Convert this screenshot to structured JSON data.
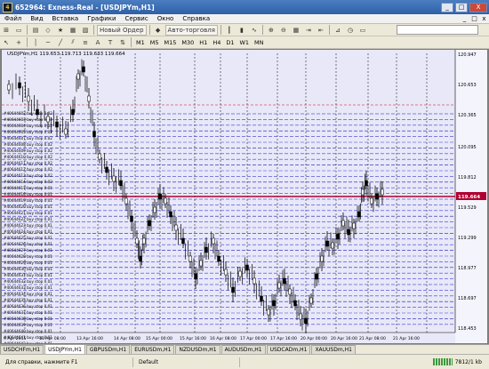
{
  "window": {
    "app_icon_text": "4",
    "title": "652964: Exness-Real - [USDJPYm,H1]",
    "minimize": "_",
    "maximize": "□",
    "close": "X"
  },
  "menu": [
    "Файл",
    "Вид",
    "Вставка",
    "Графики",
    "Сервис",
    "Окно",
    "Справка"
  ],
  "menu_sys": [
    "_",
    "□",
    "x"
  ],
  "toolbar1": {
    "new_order": "Новый Ордер",
    "auto_trading": "Авто-торговля"
  },
  "timeframes": [
    "M1",
    "M5",
    "M15",
    "M30",
    "H1",
    "H4",
    "D1",
    "W1",
    "MN"
  ],
  "chart": {
    "header": "USDJPYm,H1  119.653 119.713 119.633 119.664",
    "y_axis": [
      "120.947",
      "120.653",
      "120.365",
      "120.095",
      "119.812",
      "119.529",
      "119.299",
      "118.977",
      "118.697",
      "118.453",
      "119.115",
      "119.577"
    ],
    "x_labels": [
      "9 Apr 2015",
      "13 Apr 08:00",
      "13 Apr 16:00",
      "14 Apr 08:00",
      "15 Apr 00:00",
      "15 Apr 16:00",
      "16 Apr 08:00",
      "17 Apr 00:00",
      "17 Apr 16:00",
      "20 Apr 00:00",
      "20 Apr 16:00",
      "21 Apr 08:00",
      "21 Apr 16:00"
    ],
    "current_price": "119.664",
    "order_prefix": "#",
    "order_labels": [
      "#40644602 buy stop 0.02",
      "#40644603 buy stop 0.02",
      "#40644604 buy stop 0.02",
      "#40644605 buy stop 0.02",
      "#40644607 buy stop 0.02",
      "#40644608 buy stop 0.02",
      "#40644609 buy stop 0.02",
      "#40644610 buy stop 0.02",
      "#40644611 buy stop 0.02",
      "#40644612 buy stop 0.02",
      "#40644613 buy stop 0.02",
      "#40644614 buy stop 0.02",
      "#40644617 buy stop 0.01",
      "#40644618 buy stop 0.01",
      "#40644619 buy stop 0.01",
      "#40644620 buy stop 0.01",
      "#40644621 buy stop 0.01",
      "#40644622 buy stop 0.01",
      "#40644623 buy stop 0.01",
      "#40644624 buy stop 0.01",
      "#40644625 buy stop 0.01",
      "#40644626 buy stop 0.01",
      "#40644627 buy stop 0.01",
      "#40644628 buy stop 0.01",
      "#40644629 buy stop 0.01",
      "#40644630 buy stop 0.01",
      "#40644631 buy stop 0.01",
      "#40644632 buy stop 0.01",
      "#40644633 buy stop 0.01",
      "#40644634 buy stop 0.01",
      "#40644635 buy stop 0.01",
      "#40644636 buy stop 0.01",
      "#40644637 buy stop 0.01",
      "#40644638 buy stop 0.01",
      "#40644639 buy stop 0.01",
      "#40644640 buy stop 0.01",
      "#40644641 buy stop 0.01",
      "#40644642 buy stop 0.01"
    ]
  },
  "tabs": [
    "USDCHFm,H1",
    "USDJPYm,H1",
    "GBPUSDm,H1",
    "EURUSDm,H1",
    "NZDUSDm,H1",
    "AUDUSDm,H1",
    "USDCADm,H1",
    "XAUUSDm,H1"
  ],
  "active_tab": 1,
  "status": {
    "help": "Для справки, нажмите F1",
    "profile": "Default",
    "traffic": "7812/1 kb"
  },
  "colors": {
    "chart_bg": "#e8e8f8",
    "order_line": "#3030d8",
    "candles": "#000000",
    "bid_line": "#c01010",
    "grid": "#000000"
  }
}
